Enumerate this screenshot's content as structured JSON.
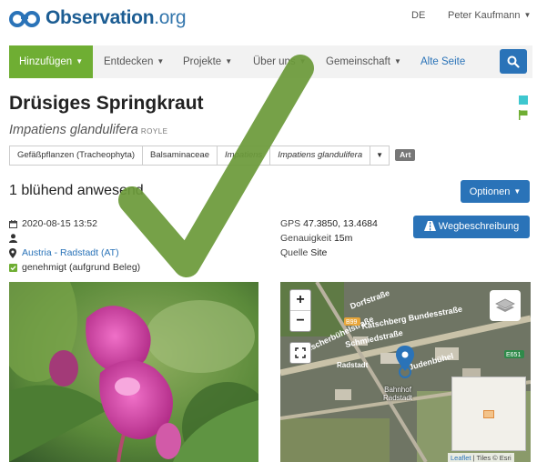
{
  "header": {
    "logo_text": "Observation",
    "logo_suffix": ".org",
    "language": "DE",
    "user_name": "Peter Kaufmann"
  },
  "nav": {
    "items": [
      {
        "label": "Hinzufügen",
        "caret": true
      },
      {
        "label": "Entdecken",
        "caret": true
      },
      {
        "label": "Projekte",
        "caret": true
      },
      {
        "label": "Über uns",
        "caret": true
      },
      {
        "label": "Gemeinschaft",
        "caret": true
      },
      {
        "label": "Alte Seite",
        "caret": false
      }
    ]
  },
  "species": {
    "common_name": "Drüsiges Springkraut",
    "scientific_name": "Impatiens glandulifera",
    "author": "ROYLE",
    "taxonomy": [
      "Gefäßpflanzen (Tracheophyta)",
      "Balsaminaceae",
      "Impatiens",
      "Impatiens glandulifera"
    ],
    "rank_badge": "Art"
  },
  "observation": {
    "count_text": "1 blühend anwesend",
    "options_label": "Optionen",
    "datetime": "2020-08-15 13:52",
    "location": "Austria - Radstadt (AT)",
    "status": "genehmigt (aufgrund Beleg)",
    "gps_label": "GPS",
    "gps_value": "47.3850, 13.4684",
    "accuracy_label": "Genauigkeit",
    "accuracy_value": "15m",
    "source_label": "Quelle",
    "source_value": "Site",
    "route_label": "Wegbeschreibung"
  },
  "map": {
    "zoom_in": "+",
    "zoom_out": "−",
    "labels": [
      "Katschberg Bundesstraße",
      "Judenbühel",
      "Radstadt",
      "Fischerbühelstraße",
      "Schmiedstraße",
      "Dorfstraße"
    ],
    "road_badges": [
      "B99",
      "E651"
    ],
    "poi_line1": "Bahnhof",
    "poi_line2": "Radstadt",
    "attribution_link": "Leaflet",
    "attribution_rest": " | Tiles © Esri"
  },
  "colors": {
    "brand_blue": "#2a73b8",
    "brand_green": "#6fae33",
    "overlay_check": "#6c9a3a"
  }
}
